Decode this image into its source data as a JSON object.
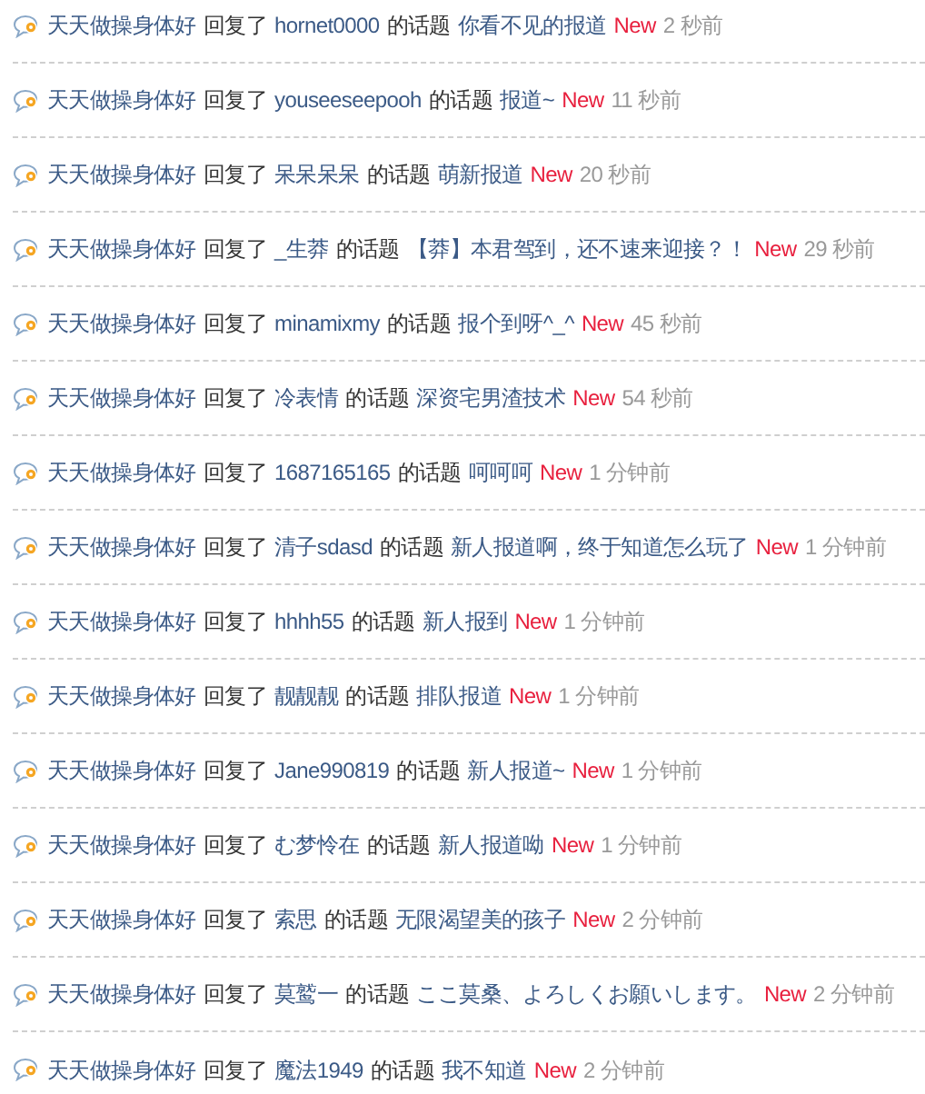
{
  "activity": [
    {
      "actor": "天天做操身体好",
      "verb": "回复了",
      "target_user": "hornet0000",
      "relation": "的话题",
      "topic": "你看不见的报道",
      "badge": "New",
      "time": "2 秒前"
    },
    {
      "actor": "天天做操身体好",
      "verb": "回复了",
      "target_user": "youseeseepooh",
      "relation": "的话题",
      "topic": "报道~",
      "badge": "New",
      "time": "11 秒前"
    },
    {
      "actor": "天天做操身体好",
      "verb": "回复了",
      "target_user": "呆呆呆呆",
      "relation": "的话题",
      "topic": "萌新报道",
      "badge": "New",
      "time": "20 秒前"
    },
    {
      "actor": "天天做操身体好",
      "verb": "回复了",
      "target_user": "_生莽",
      "relation": "的话题",
      "topic": "【莽】本君驾到，还不速来迎接？！",
      "badge": "New",
      "time": "29 秒前"
    },
    {
      "actor": "天天做操身体好",
      "verb": "回复了",
      "target_user": "minamixmy",
      "relation": "的话题",
      "topic": "报个到呀^_^",
      "badge": "New",
      "time": "45 秒前"
    },
    {
      "actor": "天天做操身体好",
      "verb": "回复了",
      "target_user": "冷表情",
      "relation": "的话题",
      "topic": "深资宅男渣技术",
      "badge": "New",
      "time": "54 秒前"
    },
    {
      "actor": "天天做操身体好",
      "verb": "回复了",
      "target_user": "1687165165",
      "relation": "的话题",
      "topic": "呵呵呵",
      "badge": "New",
      "time": "1 分钟前"
    },
    {
      "actor": "天天做操身体好",
      "verb": "回复了",
      "target_user": "清子sdasd",
      "relation": "的话题",
      "topic": "新人报道啊，终于知道怎么玩了",
      "badge": "New",
      "time": "1 分钟前"
    },
    {
      "actor": "天天做操身体好",
      "verb": "回复了",
      "target_user": "hhhh55",
      "relation": "的话题",
      "topic": "新人报到",
      "badge": "New",
      "time": "1 分钟前"
    },
    {
      "actor": "天天做操身体好",
      "verb": "回复了",
      "target_user": "靓靓靓",
      "relation": "的话题",
      "topic": "排队报道",
      "badge": "New",
      "time": "1 分钟前"
    },
    {
      "actor": "天天做操身体好",
      "verb": "回复了",
      "target_user": "Jane990819",
      "relation": "的话题",
      "topic": "新人报道~",
      "badge": "New",
      "time": "1 分钟前"
    },
    {
      "actor": "天天做操身体好",
      "verb": "回复了",
      "target_user": "む梦怜在",
      "relation": "的话题",
      "topic": "新人报道呦",
      "badge": "New",
      "time": "1 分钟前"
    },
    {
      "actor": "天天做操身体好",
      "verb": "回复了",
      "target_user": "索思",
      "relation": "的话题",
      "topic": "无限渴望美的孩子",
      "badge": "New",
      "time": "2 分钟前"
    },
    {
      "actor": "天天做操身体好",
      "verb": "回复了",
      "target_user": "莫鹫一",
      "relation": "的话题",
      "topic": "ここ莫桑、よろしくお願いします。",
      "badge": "New",
      "time": "2 分钟前"
    },
    {
      "actor": "天天做操身体好",
      "verb": "回复了",
      "target_user": "魔法1949",
      "relation": "的话题",
      "topic": "我不知道",
      "badge": "New",
      "time": "2 分钟前"
    }
  ]
}
